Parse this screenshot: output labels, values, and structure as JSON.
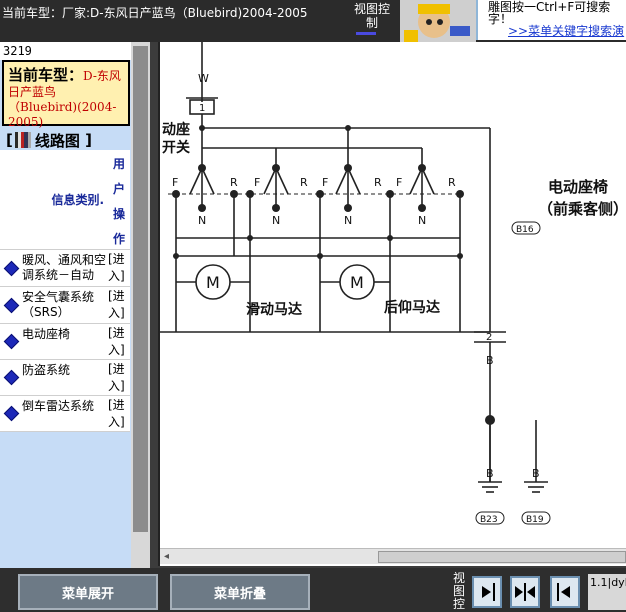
{
  "window": {
    "title": "当前车型：厂家:D-东风日产蓝鸟（Bluebird)2004-2005",
    "view_control": "视图控制"
  },
  "ad": {
    "line1": "雕图按一Ctrl+F可搜索",
    "line2": "字！",
    "link": ">>菜单关键字搜索演"
  },
  "sidebar": {
    "id": "3219",
    "current_model_label": "当前车型：",
    "current_model_value": "D-东风日产蓝鸟（Bluebird)(2004-2005)",
    "section_title": "线路图",
    "col_category": "信息类别.",
    "col_action": "用户操作",
    "items": [
      {
        "label": "暖风、通风和空调系统－自动",
        "action": "[进入]"
      },
      {
        "label": "安全气囊系统（SRS）",
        "action": "[进入]"
      },
      {
        "label": "电动座椅",
        "action": "[进入]"
      },
      {
        "label": "防盗系统",
        "action": "[进入]"
      },
      {
        "label": "倒车雷达系统",
        "action": "[进入]"
      }
    ]
  },
  "diagram": {
    "wire_top": "W",
    "connector_top": "1",
    "switch_label": "动座开关",
    "motor1_label": "滑动马达",
    "motor2_label": "后仰马达",
    "motor_symbol": "M",
    "title": "电动座椅（前乘客侧）",
    "title_line1": "电动座椅",
    "title_line2": "（前乘客侧）",
    "connector_b16": "B16",
    "connector_2": "2",
    "wire_b": "B",
    "ground1": "B23",
    "ground2": "B19",
    "switch_letters": [
      "F",
      "N",
      "R"
    ]
  },
  "toolbar": {
    "expand_menu": "菜单展开",
    "collapse_menu": "菜单折叠",
    "view_control": "视图控",
    "status": "1.1|dyb"
  }
}
